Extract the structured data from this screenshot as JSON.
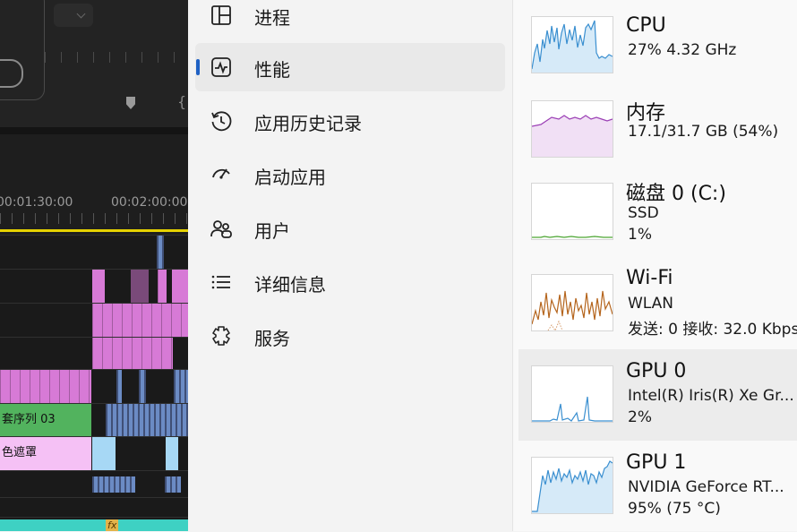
{
  "editor": {
    "timecodes": [
      "00:01:30:00",
      "00:02:00:00"
    ],
    "clip_labels": [
      "套序列 03",
      "色遮罩"
    ],
    "fx_label": "fx"
  },
  "nav": {
    "items": [
      {
        "label": "进程",
        "icon": "processes-icon",
        "active": false
      },
      {
        "label": "性能",
        "icon": "performance-icon",
        "active": true
      },
      {
        "label": "应用历史记录",
        "icon": "app-history-icon",
        "active": false
      },
      {
        "label": "启动应用",
        "icon": "startup-apps-icon",
        "active": false
      },
      {
        "label": "用户",
        "icon": "users-icon",
        "active": false
      },
      {
        "label": "详细信息",
        "icon": "details-icon",
        "active": false
      },
      {
        "label": "服务",
        "icon": "services-icon",
        "active": false
      }
    ],
    "accent_color": "#1f61c4"
  },
  "performance": {
    "items": [
      {
        "name": "CPU",
        "lines": [
          "27%  4.32 GHz"
        ],
        "color": "#3a8fd0",
        "selected": false
      },
      {
        "name": "内存",
        "lines": [
          "17.1/31.7 GB (54%)"
        ],
        "color": "#9b3fb5",
        "selected": false
      },
      {
        "name": "磁盘 0 (C:)",
        "lines": [
          "SSD",
          "1%"
        ],
        "color": "#4da633",
        "selected": false
      },
      {
        "name": "Wi-Fi",
        "lines": [
          "WLAN",
          "发送: 0 接收: 32.0 Kbps"
        ],
        "color": "#b5651d",
        "selected": false
      },
      {
        "name": "GPU 0",
        "lines": [
          "Intel(R) Iris(R) Xe Gr...",
          "2%"
        ],
        "color": "#3a8fd0",
        "selected": true
      },
      {
        "name": "GPU 1",
        "lines": [
          "NVIDIA GeForce RT...",
          "95%  (75 °C)"
        ],
        "color": "#3a8fd0",
        "selected": false
      }
    ]
  }
}
